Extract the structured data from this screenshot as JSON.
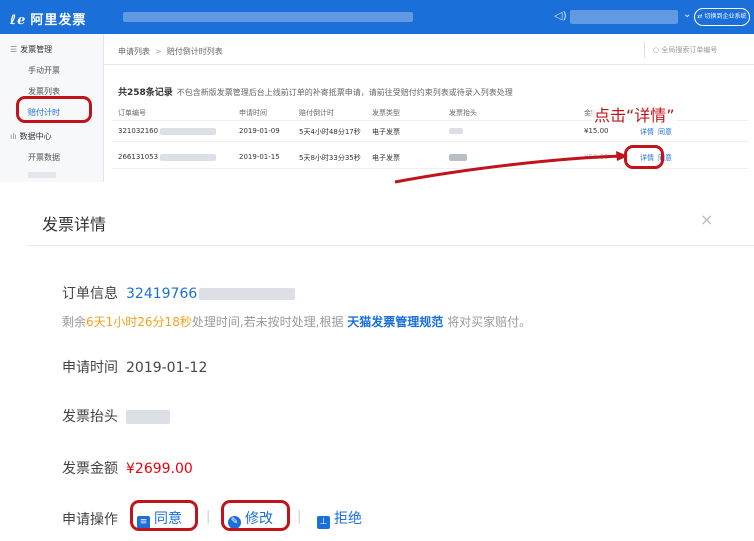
{
  "topbar": {
    "logo": "阿里发票",
    "switch_label": "⇄ 切换到企业系统",
    "accent": "#1a6fd9"
  },
  "sidebar": {
    "group1": "发票管理",
    "items": [
      "手动开票",
      "发票列表",
      "赔付计时"
    ],
    "group2": "数据中心",
    "items2": [
      "开票数据"
    ]
  },
  "list": {
    "breadcrumb": [
      "申请列表",
      "赔付倒计时列表"
    ],
    "search_placeholder": "全局搜索订单编号",
    "summary_count": "共258条记录",
    "summary_note": "不包含新版发票管理后台上线前订单的补寄抵票申请，请前往受赔付约束列表或待录入列表处理",
    "columns": [
      "订单编号",
      "申请时间",
      "赔付倒计时",
      "发票类型",
      "发票抬头",
      "金额",
      "操作"
    ],
    "rows": [
      {
        "order": "321032160",
        "date": "2019-01-09",
        "countdown": "5天4小时48分17秒",
        "type": "电子发票",
        "amount": "¥15.00",
        "detail": "详情",
        "agree": "同意"
      },
      {
        "order": "266131053",
        "date": "2019-01-15",
        "countdown": "5天8小时33分35秒",
        "type": "电子发票",
        "amount": "¥58.00",
        "detail": "详情",
        "agree": "同意"
      }
    ],
    "annotation": "点击“详情”"
  },
  "modal": {
    "title": "发票详情",
    "close": "×",
    "order_label": "订单信息",
    "order_no": "32419766",
    "warn_prefix": "剩余",
    "warn_time": "6天1小时26分18秒",
    "warn_mid": "处理时间,若未按时处理,根据",
    "warn_link": "天猫发票管理规范",
    "warn_suffix": "将对买家赔付。",
    "apply_time_label": "申请时间",
    "apply_time": "2019-01-12",
    "title_label": "发票抬头",
    "amount_label": "发票金额",
    "amount": "¥2699.00",
    "ops_label": "申请操作",
    "op_agree": "同意",
    "op_modify": "修改",
    "op_reject": "拒绝"
  }
}
